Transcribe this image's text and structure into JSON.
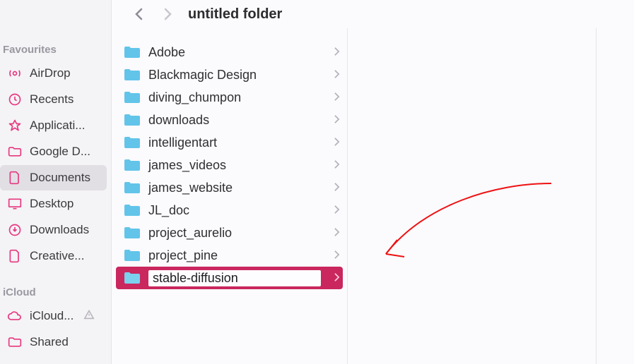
{
  "colors": {
    "accent": "#C9275E",
    "sidebar_icon": "#e63780",
    "folder": "#62c4e9"
  },
  "toolbar": {
    "title": "untitled folder"
  },
  "sidebar": {
    "sections": [
      {
        "title": "Favourites",
        "items": [
          {
            "label": "AirDrop",
            "icon": "airdrop"
          },
          {
            "label": "Recents",
            "icon": "clock"
          },
          {
            "label": "Applicati...",
            "icon": "app"
          },
          {
            "label": "Google D...",
            "icon": "folder"
          },
          {
            "label": "Documents",
            "icon": "doc",
            "active": true
          },
          {
            "label": "Desktop",
            "icon": "desktop"
          },
          {
            "label": "Downloads",
            "icon": "download"
          },
          {
            "label": "Creative...",
            "icon": "doc2"
          }
        ]
      },
      {
        "title": "iCloud",
        "items": [
          {
            "label": "iCloud...",
            "icon": "cloud",
            "warn": true
          },
          {
            "label": "Shared",
            "icon": "shared"
          }
        ]
      }
    ]
  },
  "column": {
    "folders": [
      "Adobe",
      "Blackmagic Design",
      "diving_chumpon",
      "downloads",
      "intelligentart",
      "james_videos",
      "james_website",
      "JL_doc",
      "project_aurelio",
      "project_pine"
    ],
    "editing": {
      "name": "stable-diffusion"
    }
  }
}
